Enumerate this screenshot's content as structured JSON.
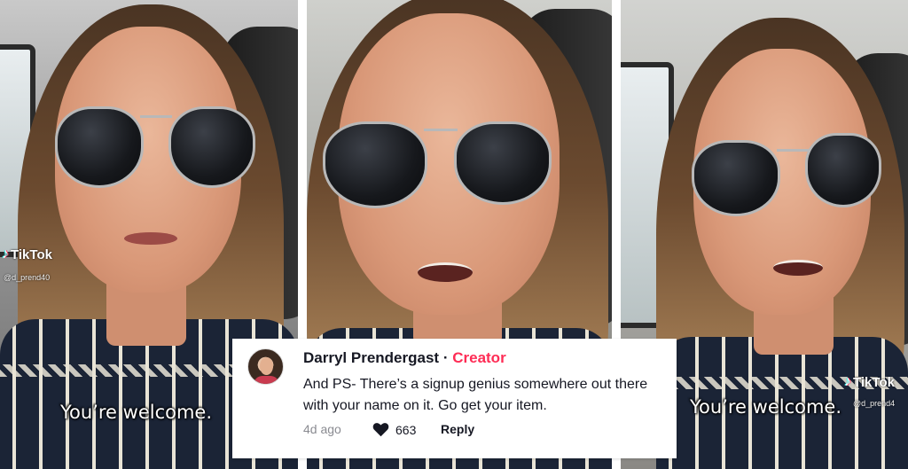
{
  "panels": [
    {
      "caption": "You’re welcome.",
      "watermark": {
        "logo": "TikTok",
        "handle": "@d_prend40"
      }
    },
    {
      "caption": ""
    },
    {
      "caption": "You’re welcome.",
      "watermark": {
        "logo": "TikTok",
        "handle": "@d_prend4"
      }
    }
  ],
  "comment": {
    "author": "Darryl Prendergast",
    "separator": "·",
    "badge": "Creator",
    "text": "And PS- There’s a signup genius somewhere out there with your name on it. Go get your item.",
    "time_ago": "4d ago",
    "like_count": "663",
    "reply_label": "Reply",
    "icons": {
      "like": "heart-icon",
      "avatar": "profile-photo"
    }
  },
  "colors": {
    "creator_badge": "#fe2c55",
    "text": "#161823",
    "meta": "#8a8b91"
  }
}
